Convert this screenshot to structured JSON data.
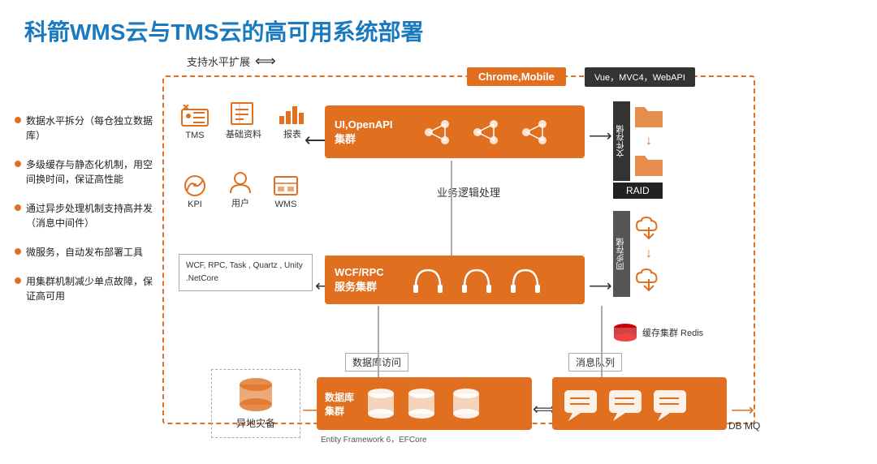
{
  "title": "科箭WMS云与TMS云的高可用系统部署",
  "expand_label": "支持水平扩展",
  "chrome_mobile": "Chrome,Mobile",
  "vue_label": "Vue，MVC4，WebAPI",
  "icons": [
    {
      "id": "tms",
      "label": "TMS"
    },
    {
      "id": "basic",
      "label": "基础资料"
    },
    {
      "id": "report",
      "label": "报表"
    },
    {
      "id": "kpi",
      "label": "KPI"
    },
    {
      "id": "user",
      "label": "用户"
    },
    {
      "id": "wms",
      "label": "WMS"
    }
  ],
  "ui_cluster_label": "UI,OpenAPI\n集群",
  "wcf_cluster_label": "WCF/RPC\n服务集群",
  "db_cluster_label": "数据库\n集群",
  "mq_cluster_label": "",
  "db_mq_text": "DB MQ",
  "wcf_left_text": "WCF, RPC, Task , Quartz ,\nUnity .NetCore",
  "business_logic_label": "业务逻辑处理",
  "db_access_label": "数据库访问",
  "mq_label": "消息队列",
  "entity_label": "Entity Framework 6，EFCore",
  "disaster_label": "异地灾备",
  "raid_label": "RAID",
  "cache_label": "缓存集群  Redis",
  "upload_label": "文件存储",
  "download_label": "同步存储",
  "bullets": [
    "数据水平拆分（每仓独立数据库）",
    "多级缓存与静态化机制，用空间换时间，保证高性能",
    "通过异步处理机制支持高并发（消息中间件）",
    "微服务，自动发布部署工具",
    "用集群机制减少单点故障，保证高可用"
  ],
  "colors": {
    "orange": "#e07020",
    "blue": "#1a7abf",
    "dark": "#222",
    "gray": "#888"
  }
}
